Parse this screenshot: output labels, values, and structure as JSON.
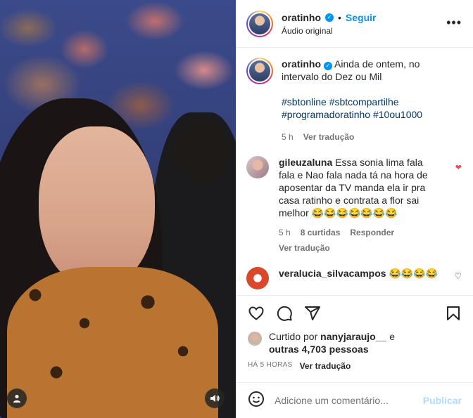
{
  "post": {
    "username": "oratinho",
    "verified": true,
    "follow_label": "Seguir",
    "audio_label": "Áudio original",
    "more_label": "•••"
  },
  "caption": {
    "username": "oratinho",
    "text": "Ainda de ontem, no intervalo do Dez ou Mil",
    "hashtags_line1": "#sbtonline #sbtcompartilhe",
    "hashtags_line2": "#programadoratinho #10ou1000",
    "time": "5 h",
    "translate_label": "Ver tradução"
  },
  "comments": [
    {
      "username": "gileuzaluna",
      "text": "Essa sonia lima fala fala e Nao fala nada tá na hora de aposentar da TV manda ela ir pra casa ratinho e contrata a flor sai melhor 😂😂😂😂😂😂😂",
      "time": "5 h",
      "likes": "8 curtidas",
      "reply_label": "Responder",
      "translate_label": "Ver tradução",
      "liked": true
    },
    {
      "username": "veralucia_silvacampos",
      "text": "😂😂😂😂",
      "liked": false
    }
  ],
  "likes": {
    "prefix": "Curtido por",
    "user": "nanyjaraujo__",
    "connector": "e",
    "others": "outras 4,703 pessoas"
  },
  "timestamp": "HÁ 5 HORAS",
  "timestamp_translate": "Ver tradução",
  "comment_input": {
    "placeholder": "Adicione um comentário...",
    "publish_label": "Publicar"
  },
  "icons": {
    "like": "heart-icon",
    "comment": "comment-icon",
    "share": "share-icon",
    "save": "bookmark-icon",
    "emoji": "emoji-icon",
    "more": "more-icon",
    "user_tag": "user-icon",
    "sound": "speaker-icon"
  },
  "colors": {
    "accent": "#0095f6",
    "hashtag": "#00376b",
    "secondary": "#737373",
    "liked_heart": "#ed4956",
    "publish_disabled": "#b3dbff"
  }
}
